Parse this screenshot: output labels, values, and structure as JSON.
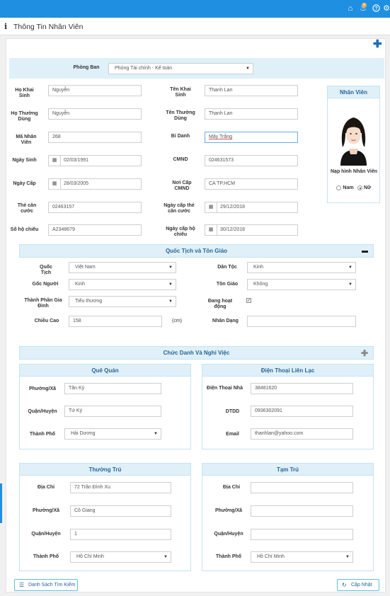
{
  "topbar": {
    "notification_count": "9"
  },
  "header": {
    "title": "Thông Tin Nhân Viên"
  },
  "department": {
    "label": "Phòng Ban",
    "value": "Phòng Tài chính - Kế toán"
  },
  "personal": {
    "ho_khai_sinh": {
      "label": "Họ Khai Sinh",
      "value": "Nguyễn"
    },
    "ten_khai_sinh": {
      "label": "Tên Khai Sinh",
      "value": "Thanh Lan"
    },
    "ho_thuong_dung": {
      "label": "Họ Thường Dùng",
      "value": "Nguyễn"
    },
    "ten_thuong_dung": {
      "label": "Tên Thường Dùng",
      "value": "Thanh Lan"
    },
    "ma_nhan_vien": {
      "label": "Mã Nhân Viên",
      "value": "268"
    },
    "bi_danh": {
      "label": "Bí Danh",
      "value": "Mây Trắng"
    },
    "ngay_sinh": {
      "label": "Ngày Sinh",
      "value": "02/03/1991"
    },
    "cmnd": {
      "label": "CMND",
      "value": "024631573"
    },
    "ngay_cap": {
      "label": "Ngày Cấp",
      "value": "28/03/2005"
    },
    "noi_cap": {
      "label": "Nơi Cấp CMND",
      "value": "CA TP.HCM"
    },
    "the_can_cuoc": {
      "label": "Thẻ căn cước",
      "value": "02463157"
    },
    "ngay_cap_the": {
      "label": "Ngày cấp thẻ căn cước",
      "value": "29/12/2018"
    },
    "so_ho_chieu": {
      "label": "Số hộ chiếu",
      "value": "A2348679"
    },
    "ngay_cap_ho_chieu": {
      "label": "Ngày cấp hộ chiếu",
      "value": "30/12/2018"
    }
  },
  "employee_card": {
    "title": "Nhân Viên",
    "upload_label": "Nạp hình Nhân Viên",
    "gender_male": "Nam",
    "gender_female": "Nữ"
  },
  "nationality_section": {
    "title": "Quốc Tịch và Tôn Giáo",
    "quoc_tich": {
      "label": "Quốc Tịch",
      "value": "Việt Nam"
    },
    "dan_toc": {
      "label": "Dân Tộc",
      "value": "Kinh"
    },
    "goc_nguoi": {
      "label": "Gốc Người",
      "value": "Kinh"
    },
    "ton_giao": {
      "label": "Tôn Giáo",
      "value": "Không"
    },
    "thanh_phan": {
      "label": "Thành Phần Gia Đình",
      "value": "Tiểu thương"
    },
    "dang_hoat_dong": {
      "label": "Đang hoạt động"
    },
    "chieu_cao": {
      "label": "Chiều Cao",
      "value": "158",
      "unit": "(cm)"
    },
    "nhan_dang": {
      "label": "Nhân Dạng",
      "value": ""
    }
  },
  "job_section": {
    "title": "Chức Danh Và Nghỉ Việc"
  },
  "que_quan": {
    "title": "Quê Quán",
    "phuong": {
      "label": "Phường/Xã",
      "value": "Tân Kỳ"
    },
    "quan": {
      "label": "Quận/Huyện",
      "value": "Tứ Kỳ"
    },
    "thanh_pho": {
      "label": "Thành Phố",
      "value": "Hải Dương"
    }
  },
  "dien_thoai": {
    "title": "Điện Thoại Liên Lạc",
    "nha": {
      "label": "Điện Thoại Nhà",
      "value": "38481620"
    },
    "dtdd": {
      "label": "DTDD",
      "value": "0936302091"
    },
    "email": {
      "label": "Email",
      "value": "thanhlan@yahoo.com"
    }
  },
  "thuong_tru": {
    "title": "Thường Trú",
    "dia_chi": {
      "label": "Địa Chỉ",
      "value": "72 Trần Đình Xu"
    },
    "phuong": {
      "label": "Phường/Xã",
      "value": "Cô Giang"
    },
    "quan": {
      "label": "Quận/Huyện",
      "value": "1"
    },
    "thanh_pho": {
      "label": "Thành Phố",
      "value": "Hồ Chí Minh"
    }
  },
  "tam_tru": {
    "title": "Tạm Trú",
    "dia_chi": {
      "label": "Địa Chỉ",
      "value": ""
    },
    "phuong": {
      "label": "Phường/Xã",
      "value": ""
    },
    "quan": {
      "label": "Quận/Huyện",
      "value": ""
    },
    "thanh_pho": {
      "label": "Thành Phố",
      "value": "Hồ Chí Minh"
    }
  },
  "footer": {
    "search_list_label": "Danh Sách Tìm Kiếm",
    "update_label": "Cập Nhật"
  },
  "colors": {
    "topbar": "#1e8fe1",
    "section": "#dff0f8",
    "accent_text": "#2a6496"
  }
}
